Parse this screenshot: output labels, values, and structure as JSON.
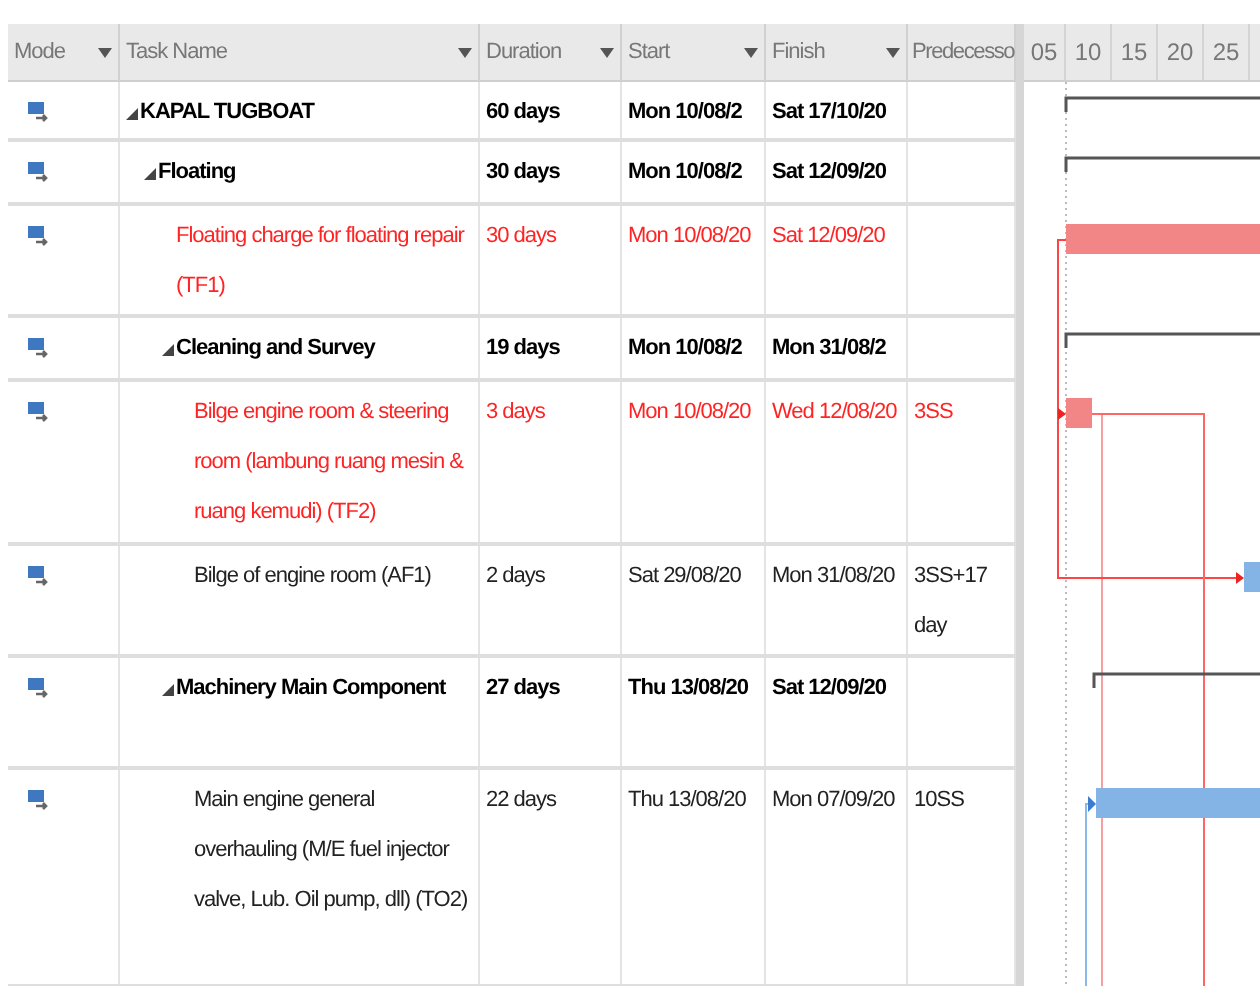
{
  "columns": [
    {
      "label": "Mode",
      "filter": true
    },
    {
      "label": "Task Name",
      "filter": true
    },
    {
      "label": "Duration",
      "filter": true
    },
    {
      "label": "Start",
      "filter": true
    },
    {
      "label": "Finish",
      "filter": true
    },
    {
      "label": "Predecesso",
      "filter": false
    }
  ],
  "timescale": [
    "05",
    "10",
    "15",
    "20",
    "25"
  ],
  "tasks": [
    {
      "kind": "summary",
      "expanded": true,
      "name": "KAPAL TUGBOAT",
      "duration": "60 days",
      "start": "Mon 10/08/2",
      "finish": "Sat 17/10/20",
      "children": [
        {
          "kind": "summary",
          "expanded": true,
          "name": "Floating",
          "duration": "30 days",
          "start": "Mon 10/08/2",
          "finish": "Sat 12/09/20",
          "children": [
            {
              "kind": "critical",
              "name": "Floating charge for floating repair (TF1)",
              "duration": "30 days",
              "start": "Mon 10/08/20",
              "finish": "Sat 12/09/20"
            },
            {
              "kind": "summary",
              "expanded": true,
              "name": "Cleaning and Survey",
              "duration": "19 days",
              "start": "Mon 10/08/2",
              "finish": "Mon 31/08/2",
              "children": [
                {
                  "kind": "critical",
                  "name": "Bilge engine room & steering room (lambung ruang mesin & ruang kemudi) (TF2)",
                  "duration": "3 days",
                  "start": "Mon 10/08/20",
                  "finish": "Wed 12/08/20",
                  "predecessors": "3SS"
                },
                {
                  "kind": "task",
                  "name": "Bilge of engine room (AF1)",
                  "duration": "2 days",
                  "start": "Sat 29/08/20",
                  "finish": "Mon 31/08/20",
                  "predecessors": "3SS+17 day"
                }
              ]
            },
            {
              "kind": "summary",
              "expanded": true,
              "name": "Machinery Main Component",
              "duration": "27 days",
              "start": "Thu 13/08/20",
              "finish": "Sat 12/09/20",
              "children": [
                {
                  "kind": "task",
                  "name": "Main engine general overhauling (M/E fuel injector valve, Lub. Oil pump, dll) (TO2)",
                  "duration": "22 days",
                  "start": "Thu 13/08/20",
                  "finish": "Mon 07/09/20",
                  "predecessors": "10SS"
                }
              ]
            }
          ]
        }
      ]
    }
  ]
}
